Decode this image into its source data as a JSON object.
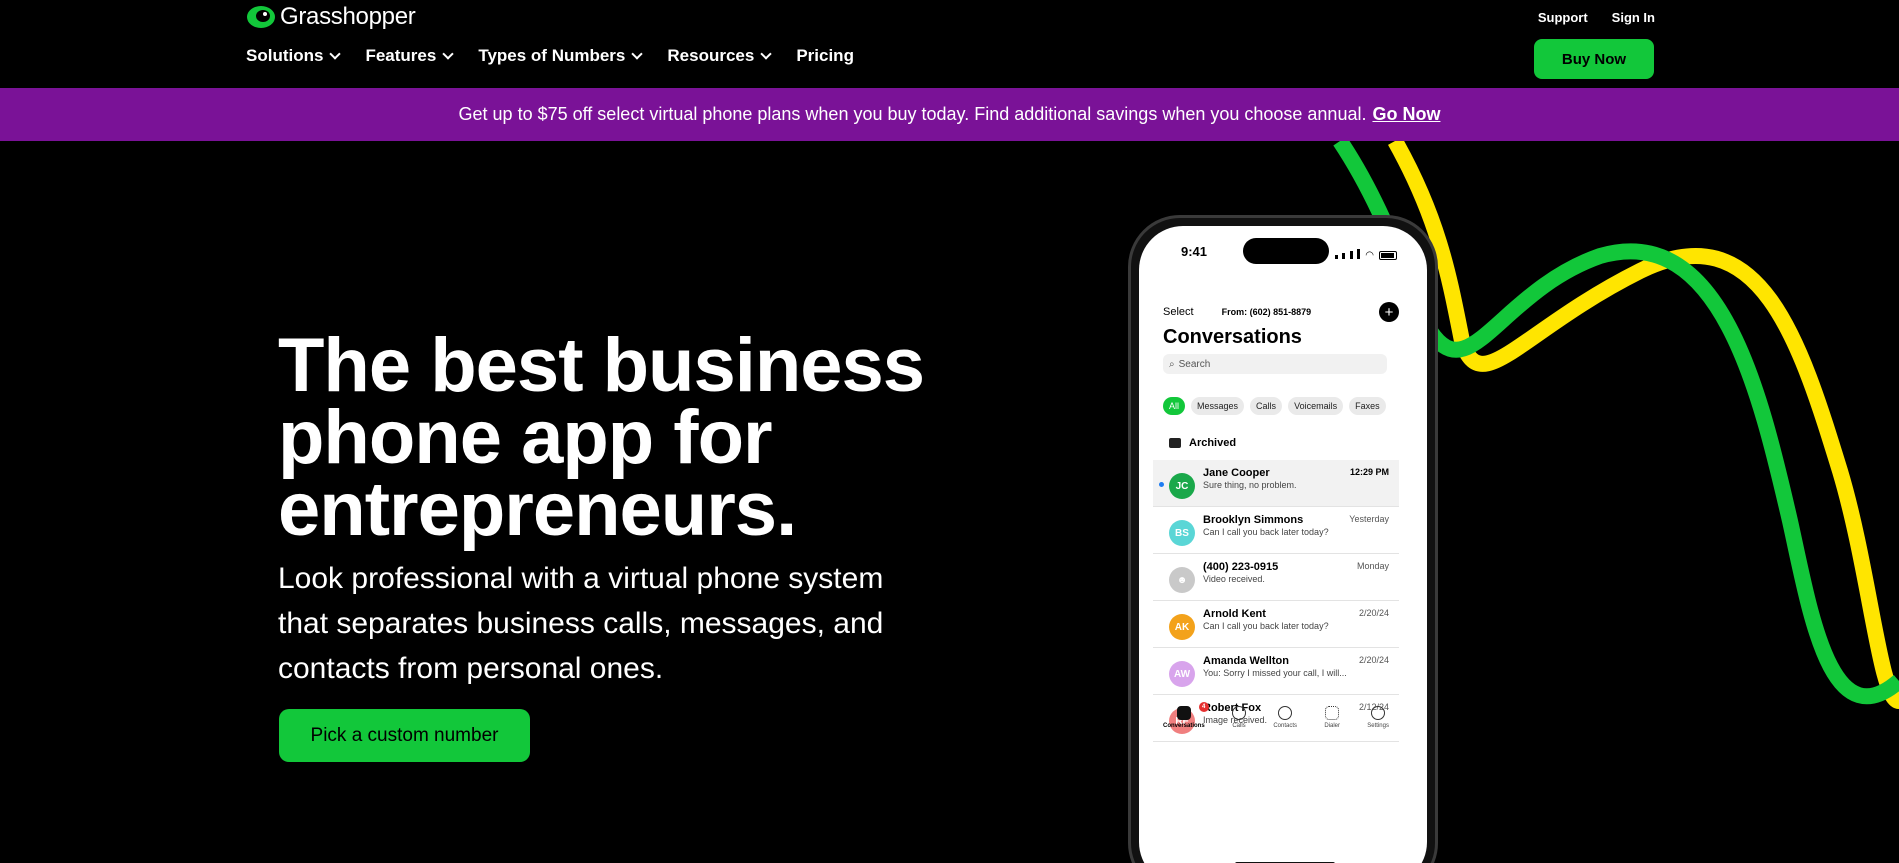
{
  "brand": {
    "name": "Grasshopper"
  },
  "nav": {
    "items": [
      {
        "label": "Solutions",
        "dropdown": true
      },
      {
        "label": "Features",
        "dropdown": true
      },
      {
        "label": "Types of Numbers",
        "dropdown": true
      },
      {
        "label": "Resources",
        "dropdown": true
      },
      {
        "label": "Pricing",
        "dropdown": false
      }
    ],
    "support": "Support",
    "signin": "Sign In",
    "buy": "Buy Now"
  },
  "promo": {
    "text": "Get up to $75 off select virtual phone plans when you buy today. Find additional savings when you choose annual.",
    "link": "Go Now"
  },
  "hero": {
    "title_lines": [
      "The best business",
      "phone app for",
      "entrepreneurs."
    ],
    "subtitle_lines": [
      "Look professional with a virtual phone system",
      "that separates business calls, messages, and",
      "contacts from personal ones."
    ],
    "cta": "Pick a custom number"
  },
  "phone": {
    "time": "9:41",
    "select": "Select",
    "from": "From: (602) 851-8879",
    "plus": "+",
    "title": "Conversations",
    "search_placeholder": "Search",
    "chips": [
      "All",
      "Messages",
      "Calls",
      "Voicemails",
      "Faxes"
    ],
    "archived": "Archived",
    "conversations": [
      {
        "initials": "JC",
        "name": "Jane Cooper",
        "message": "Sure thing, no problem.",
        "date": "12:29 PM",
        "color": "#1aa84a",
        "unread": true
      },
      {
        "initials": "BS",
        "name": "Brooklyn Simmons",
        "message": "Can I call you back later today?",
        "date": "Yesterday",
        "color": "#5ad6d6",
        "unread": false
      },
      {
        "initials": "",
        "name": "(400) 223-0915",
        "message": "Video received.",
        "date": "Monday",
        "color": "#c9c9c9",
        "unread": false
      },
      {
        "initials": "AK",
        "name": "Arnold Kent",
        "message": "Can I call you back later today?",
        "date": "2/20/24",
        "color": "#f3a21b",
        "unread": false
      },
      {
        "initials": "AW",
        "name": "Amanda Wellton",
        "message": "You: Sorry I missed your call, I will...",
        "date": "2/20/24",
        "color": "#d8a4ec",
        "unread": false
      },
      {
        "initials": "RF",
        "name": "Robert Fox",
        "message": "Image received.",
        "date": "2/12/24",
        "color": "#f07f7f",
        "unread": false
      }
    ],
    "tabs": [
      "Conversations",
      "Calls",
      "Contacts",
      "Dialer",
      "Settings"
    ],
    "badge": "4"
  },
  "colors": {
    "accent_green": "#12c73a",
    "promo_purple": "#7a1297",
    "wave_yellow": "#ffe500"
  }
}
